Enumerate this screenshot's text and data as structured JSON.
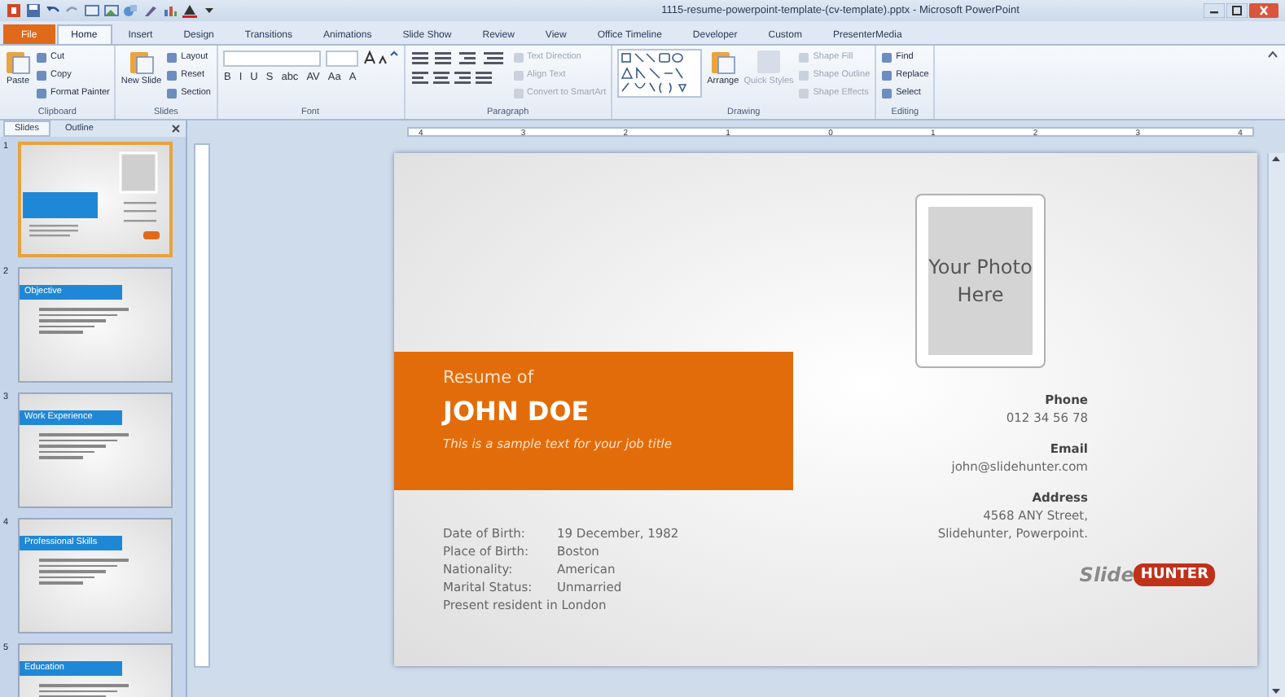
{
  "window": {
    "title": "1115-resume-powerpoint-template-(cv-template).pptx - Microsoft PowerPoint"
  },
  "ribbon": {
    "tabs": [
      {
        "label": "File",
        "kind": "file",
        "selected": false
      },
      {
        "label": "Home",
        "kind": "tab",
        "selected": true
      },
      {
        "label": "Insert",
        "kind": "tab",
        "selected": false
      },
      {
        "label": "Design",
        "kind": "tab",
        "selected": false
      },
      {
        "label": "Transitions",
        "kind": "tab",
        "selected": false
      },
      {
        "label": "Animations",
        "kind": "tab",
        "selected": false
      },
      {
        "label": "Slide Show",
        "kind": "tab",
        "selected": false
      },
      {
        "label": "Review",
        "kind": "tab",
        "selected": false
      },
      {
        "label": "View",
        "kind": "tab",
        "selected": false
      },
      {
        "label": "Office Timeline",
        "kind": "tab",
        "selected": false
      },
      {
        "label": "Developer",
        "kind": "tab",
        "selected": false
      },
      {
        "label": "Custom",
        "kind": "tab",
        "selected": false
      },
      {
        "label": "PresenterMedia",
        "kind": "tab",
        "selected": false
      }
    ],
    "groups": [
      {
        "label": "Clipboard",
        "kind": "clipboard",
        "large": [
          {
            "label": "Paste",
            "disabled": false
          }
        ],
        "small": [
          {
            "label": "Cut",
            "disabled": false
          },
          {
            "label": "Copy",
            "disabled": false
          },
          {
            "label": "Format Painter",
            "disabled": false
          }
        ]
      },
      {
        "label": "Slides",
        "kind": "slides",
        "large": [
          {
            "label": "New Slide",
            "disabled": false
          }
        ],
        "small": [
          {
            "label": "Layout",
            "disabled": false
          },
          {
            "label": "Reset",
            "disabled": false
          },
          {
            "label": "Section",
            "disabled": false
          }
        ]
      },
      {
        "label": "Font",
        "kind": "font",
        "glyphs": [
          "B",
          "I",
          "U",
          "S",
          "abc",
          "AV",
          "Aa",
          "A"
        ]
      },
      {
        "label": "Paragraph",
        "kind": "paragraph",
        "small": [
          {
            "label": "Text Direction",
            "disabled": true
          },
          {
            "label": "Align Text",
            "disabled": true
          },
          {
            "label": "Convert to SmartArt",
            "disabled": true
          }
        ]
      },
      {
        "label": "Drawing",
        "kind": "drawing",
        "large": [
          {
            "label": "Arrange",
            "disabled": false
          },
          {
            "label": "Quick Styles",
            "disabled": true
          }
        ],
        "small": [
          {
            "label": "Shape Fill",
            "disabled": true
          },
          {
            "label": "Shape Outline",
            "disabled": true
          },
          {
            "label": "Shape Effects",
            "disabled": true
          }
        ]
      },
      {
        "label": "Editing",
        "kind": "editing",
        "small": [
          {
            "label": "Find",
            "disabled": false
          },
          {
            "label": "Replace",
            "disabled": false
          },
          {
            "label": "Select",
            "disabled": false
          }
        ]
      }
    ]
  },
  "panel": {
    "tabs": [
      {
        "label": "Slides",
        "selected": true
      },
      {
        "label": "Outline",
        "selected": false
      }
    ],
    "thumbnails": [
      {
        "number": "1",
        "kind": "cover",
        "selected": true
      },
      {
        "number": "2",
        "kind": "section",
        "heading": "Objective",
        "selected": false
      },
      {
        "number": "3",
        "kind": "section",
        "heading": "Work Experience",
        "selected": false
      },
      {
        "number": "4",
        "kind": "section",
        "heading": "Professional Skills",
        "selected": false
      },
      {
        "number": "5",
        "kind": "section",
        "heading": "Education",
        "selected": false
      }
    ]
  },
  "ruler": {
    "marks": [
      "4",
      "3",
      "2",
      "1",
      "0",
      "1",
      "2",
      "3",
      "4"
    ]
  },
  "slide": {
    "intro": "Resume of",
    "name": "JOHN DOE",
    "job_title": "This is a sample text for your job title",
    "details": [
      {
        "label": "Date of Birth:",
        "value": "19 December, 1982"
      },
      {
        "label": "Place of Birth:",
        "value": "Boston"
      },
      {
        "label": "Nationality:",
        "value": "American"
      },
      {
        "label": "Marital Status:",
        "value": "Unmarried"
      }
    ],
    "residence": "Present resident in London",
    "photo_placeholder": "Your Photo Here",
    "contacts": [
      {
        "heading": "Phone",
        "lines": [
          "012 34 56 78"
        ]
      },
      {
        "heading": "Email",
        "lines": [
          "john@slidehunter.com"
        ]
      },
      {
        "heading": "Address",
        "lines": [
          "4568 ANY Street,",
          "Slidehunter, Powerpoint."
        ]
      }
    ],
    "logo": {
      "left": "Slide",
      "right": "HUNTER"
    }
  }
}
